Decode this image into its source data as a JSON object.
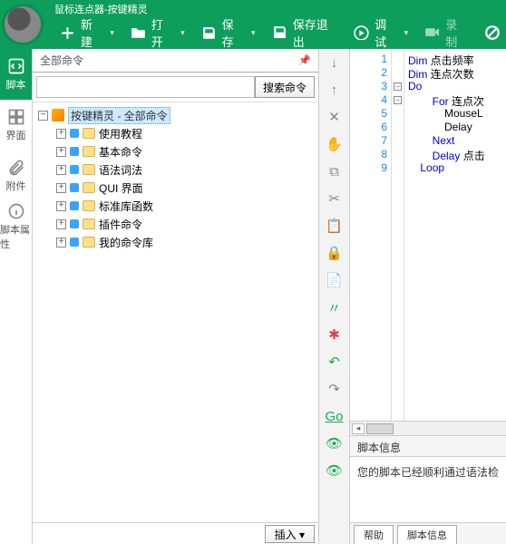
{
  "title": "鼠标连点器-按键精灵",
  "toolbar": {
    "new": "新建",
    "open": "打开",
    "save": "保存",
    "save_exit": "保存退出",
    "debug": "调试",
    "record": "录制",
    "other": ""
  },
  "leftnav": [
    {
      "id": "script",
      "label": "脚本"
    },
    {
      "id": "ui",
      "label": "界面"
    },
    {
      "id": "attach",
      "label": "附件"
    },
    {
      "id": "props",
      "label": "脚本属性"
    }
  ],
  "panel": {
    "header": "全部命令",
    "search_placeholder": "",
    "search_btn": "搜索命令",
    "root": "按键精灵 - 全部命令",
    "items": [
      "使用教程",
      "基本命令",
      "语法词法",
      "QUI 界面",
      "标准库函数",
      "插件命令",
      "我的命令库"
    ],
    "insert": "插入 ▾"
  },
  "code": {
    "lines": [
      {
        "n": 1,
        "kw": "Dim",
        "rest": " 点击频率"
      },
      {
        "n": 2,
        "kw": "Dim",
        "rest": " 连点次数"
      },
      {
        "n": 3,
        "kw": "Do",
        "rest": ""
      },
      {
        "n": 4,
        "indent": 2,
        "kw": "For",
        "rest": " 连点次"
      },
      {
        "n": 5,
        "indent": 3,
        "kw": "",
        "rest": "MouseL"
      },
      {
        "n": 6,
        "indent": 3,
        "kw": "",
        "rest": "Delay"
      },
      {
        "n": 7,
        "indent": 2,
        "kw": "Next",
        "rest": ""
      },
      {
        "n": 8,
        "indent": 2,
        "kw": "Delay",
        "rest": " 点击"
      },
      {
        "n": 9,
        "indent": 1,
        "kw": "Loop",
        "rest": ""
      }
    ]
  },
  "info": {
    "header": "脚本信息",
    "body": "您的脚本已经顺利通过语法检"
  },
  "tabs": {
    "help": "帮助",
    "info": "脚本信息"
  }
}
